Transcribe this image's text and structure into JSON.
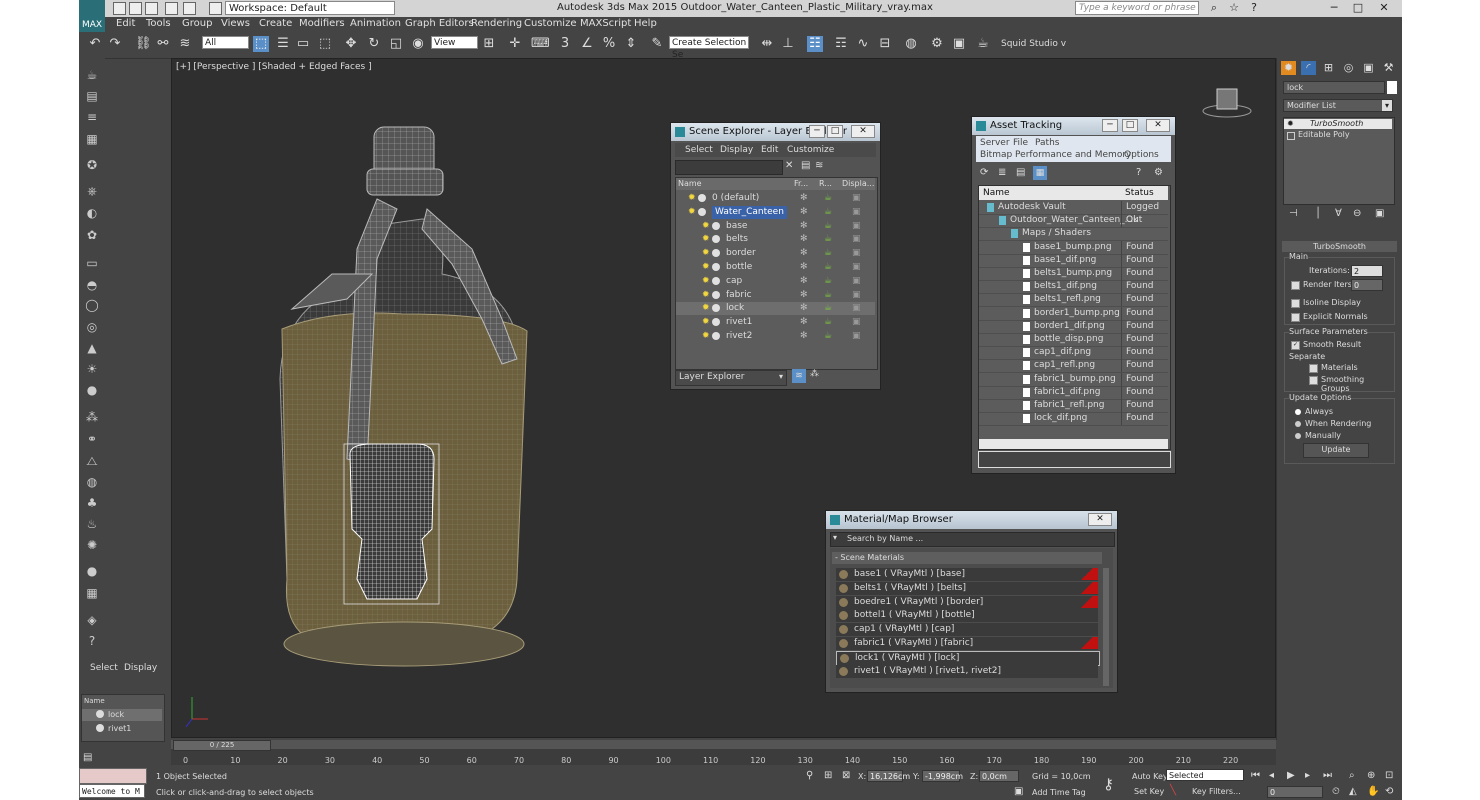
{
  "title_bar": {
    "logo": "MAX",
    "workspace": "Workspace: Default",
    "title": "Autodesk 3ds Max 2015    Outdoor_Water_Canteen_Plastic_Military_vray.max",
    "search_placeholder": "Type a keyword or phrase"
  },
  "menu": [
    "Edit",
    "Tools",
    "Group",
    "Views",
    "Create",
    "Modifiers",
    "Animation",
    "Graph Editors",
    "Rendering",
    "Customize",
    "MAXScript",
    "Help"
  ],
  "toolbar": {
    "selection_filter": "All",
    "reference_coord": "View",
    "selection_set": "Create Selection Se",
    "studio_label": "Squid Studio v"
  },
  "viewport": {
    "label": "[+] [Perspective ] [Shaded + Edged Faces ]"
  },
  "scene_explorer": {
    "title": "Scene Explorer - Layer Explorer",
    "menu": [
      "Select",
      "Display",
      "Edit",
      "Customize"
    ],
    "columns": [
      "Name",
      "Fr...",
      "R...",
      "Displa..."
    ],
    "rows": [
      {
        "name": "0 (default)",
        "level": 0
      },
      {
        "name": "Water_Canteen",
        "level": 0,
        "selected": true
      },
      {
        "name": "base",
        "level": 1
      },
      {
        "name": "belts",
        "level": 1
      },
      {
        "name": "border",
        "level": 1
      },
      {
        "name": "bottle",
        "level": 1
      },
      {
        "name": "cap",
        "level": 1
      },
      {
        "name": "fabric",
        "level": 1
      },
      {
        "name": "lock",
        "level": 1,
        "highlight": true
      },
      {
        "name": "rivet1",
        "level": 1
      },
      {
        "name": "rivet2",
        "level": 1
      }
    ],
    "footer_mode": "Layer Explorer"
  },
  "asset_tracking": {
    "title": "Asset Tracking",
    "menu1": [
      "Server",
      "File",
      "Paths"
    ],
    "menu2": [
      "Bitmap Performance and Memory",
      "Options"
    ],
    "columns": [
      "Name",
      "Status"
    ],
    "rows": [
      {
        "name": "Autodesk Vault",
        "status": "Logged Out",
        "level": 0
      },
      {
        "name": "Outdoor_Water_Canteen_...",
        "status": "Ok",
        "level": 1
      },
      {
        "name": "Maps / Shaders",
        "status": "",
        "level": 2
      },
      {
        "name": "base1_bump.png",
        "status": "Found",
        "level": 3
      },
      {
        "name": "base1_dif.png",
        "status": "Found",
        "level": 3
      },
      {
        "name": "belts1_bump.png",
        "status": "Found",
        "level": 3
      },
      {
        "name": "belts1_dif.png",
        "status": "Found",
        "level": 3
      },
      {
        "name": "belts1_refl.png",
        "status": "Found",
        "level": 3
      },
      {
        "name": "border1_bump.png",
        "status": "Found",
        "level": 3
      },
      {
        "name": "border1_dif.png",
        "status": "Found",
        "level": 3
      },
      {
        "name": "bottle_disp.png",
        "status": "Found",
        "level": 3
      },
      {
        "name": "cap1_dif.png",
        "status": "Found",
        "level": 3
      },
      {
        "name": "cap1_refl.png",
        "status": "Found",
        "level": 3
      },
      {
        "name": "fabric1_bump.png",
        "status": "Found",
        "level": 3
      },
      {
        "name": "fabric1_dif.png",
        "status": "Found",
        "level": 3
      },
      {
        "name": "fabric1_refl.png",
        "status": "Found",
        "level": 3
      },
      {
        "name": "lock_dif.png",
        "status": "Found",
        "level": 3
      }
    ]
  },
  "material_browser": {
    "title": "Material/Map Browser",
    "search_placeholder": "Search by Name ...",
    "section": "- Scene Materials",
    "rows": [
      {
        "label": "base1  ( VRayMtl ) [base]",
        "flag": true
      },
      {
        "label": "belts1  ( VRayMtl ) [belts]",
        "flag": true
      },
      {
        "label": "boedre1  ( VRayMtl ) [border]",
        "flag": true
      },
      {
        "label": "bottel1  ( VRayMtl ) [bottle]",
        "flag": false
      },
      {
        "label": "cap1  ( VRayMtl ) [cap]",
        "flag": false
      },
      {
        "label": "fabric1  ( VRayMtl ) [fabric]",
        "flag": true
      },
      {
        "label": "lock1  ( VRayMtl ) [lock]",
        "flag": false,
        "selected": true
      },
      {
        "label": "rivet1  ( VRayMtl ) [rivet1, rivet2]",
        "flag": false
      }
    ]
  },
  "command_panel": {
    "search_value": "lock",
    "modifier_list": "Modifier List",
    "stack": [
      "TurboSmooth",
      "Editable Poly"
    ],
    "rollout_title": "TurboSmooth",
    "main_label": "Main",
    "iterations_label": "Iterations:",
    "iterations_value": "2",
    "render_iters_label": "Render Iters:",
    "render_iters_value": "0",
    "isoline": "Isoline Display",
    "explicit_normals": "Explicit Normals",
    "surface_params": "Surface Parameters",
    "smooth_result": "Smooth Result",
    "separate": "Separate",
    "materials": "Materials",
    "smoothing_groups": "Smoothing Groups",
    "update_options": "Update Options",
    "always": "Always",
    "when_rendering": "When Rendering",
    "manually": "Manually",
    "update_button": "Update"
  },
  "left_select_panel": {
    "tabs": [
      "Select",
      "Display"
    ],
    "column": "Name",
    "items": [
      "lock",
      "rivet1"
    ]
  },
  "timeline": {
    "frame": "0 / 225",
    "ticks": [
      "0",
      "10",
      "20",
      "30",
      "40",
      "50",
      "60",
      "70",
      "80",
      "90",
      "100",
      "110",
      "120",
      "130",
      "140",
      "150",
      "160",
      "170",
      "180",
      "190",
      "200",
      "210",
      "220"
    ]
  },
  "status_bar": {
    "maxscript": "Welcome to M",
    "selected": "1 Object Selected",
    "prompt": "Click or click-and-drag to select objects",
    "x_label": "X:",
    "x": "16,126cm",
    "y_label": "Y:",
    "y": "-1,998cm",
    "z_label": "Z:",
    "z": "0,0cm",
    "grid": "Grid = 10,0cm",
    "add_time_tag": "Add Time Tag",
    "auto_key": "Auto Key",
    "auto_key_mode": "Selected",
    "set_key": "Set Key",
    "key_filters": "Key Filters...",
    "frame_field": "0"
  },
  "colors": {
    "accent": "#2a8a98",
    "wire_white": "#ffffff",
    "fabric": "#6b5f3e",
    "flag_red": "#c01010"
  }
}
